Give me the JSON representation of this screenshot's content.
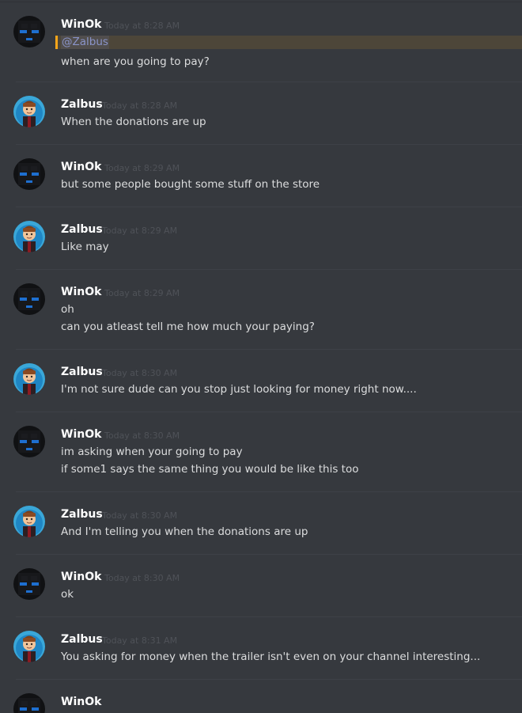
{
  "messages": [
    {
      "user": "WinOk",
      "time": "Today at 8:28 AM",
      "mention": "@Zalbus",
      "lines": [
        "when are you going to pay?"
      ],
      "avatar": "enderman-avatar"
    },
    {
      "user": "Zalbus",
      "time": "Today at 8:28 AM",
      "lines": [
        "When the donations are up"
      ],
      "avatar": "zalbus-avatar"
    },
    {
      "user": "WinOk",
      "time": "Today at 8:29 AM",
      "lines": [
        "but some people bought some stuff on the store"
      ],
      "avatar": "enderman-avatar"
    },
    {
      "user": "Zalbus",
      "time": "Today at 8:29 AM",
      "lines": [
        "Like may"
      ],
      "avatar": "zalbus-avatar"
    },
    {
      "user": "WinOk",
      "time": "Today at 8:29 AM",
      "lines": [
        "oh",
        "can you atleast tell me how much your paying?"
      ],
      "avatar": "enderman-avatar"
    },
    {
      "user": "Zalbus",
      "time": "Today at 8:30 AM",
      "lines": [
        "I'm not sure dude can you stop just looking for money right now...."
      ],
      "avatar": "zalbus-avatar"
    },
    {
      "user": "WinOk",
      "time": "Today at 8:30 AM",
      "lines": [
        "im asking when your going to pay",
        "if some1 says the same thing you would be like this too"
      ],
      "avatar": "enderman-avatar"
    },
    {
      "user": "Zalbus",
      "time": "Today at 8:30 AM",
      "lines": [
        "And I'm telling you when the donations are up"
      ],
      "avatar": "zalbus-avatar"
    },
    {
      "user": "WinOk",
      "time": "Today at 8:30 AM",
      "lines": [
        "ok"
      ],
      "avatar": "enderman-avatar"
    },
    {
      "user": "Zalbus",
      "time": "Today at 8:31 AM",
      "lines": [
        "You asking for money when the trailer isn't even on your channel interesting..."
      ],
      "avatar": "zalbus-avatar"
    },
    {
      "user": "WinOk",
      "time": "",
      "lines": [],
      "avatar": "enderman-avatar"
    }
  ],
  "colors": {
    "background": "#36393e",
    "username": "#ffffff",
    "timestamp": "#4f5258",
    "text": "#dcddde",
    "mention_bar": "#faa61a",
    "mention_text": "#8a94c9"
  }
}
